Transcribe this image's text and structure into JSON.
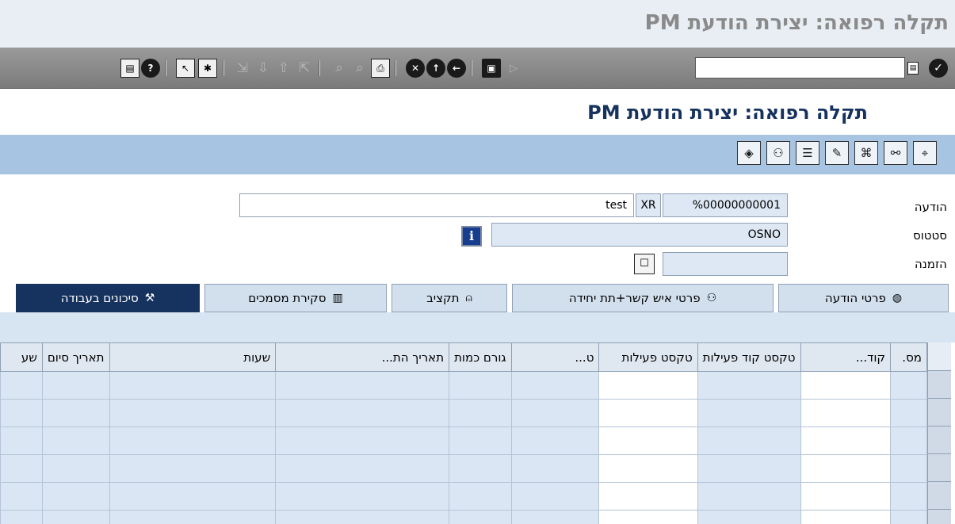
{
  "window": {
    "title": "תקלה רפואה: יצירת הודעת PM"
  },
  "toolbar": {
    "command_value": "",
    "icons": [
      "enter-icon",
      "command-field-icon",
      "next-icon",
      "save-icon",
      "back-icon",
      "exit-icon",
      "cancel-icon",
      "print-icon",
      "find-icon",
      "find-next-icon",
      "first-page-icon",
      "previous-page-icon",
      "next-page-icon",
      "last-page-icon",
      "new-session-icon",
      "shortcut-icon",
      "help-icon",
      "layout-menu-icon"
    ]
  },
  "screen": {
    "title": "תקלה רפואה: יצירת הודעת PM"
  },
  "app_toolbar": {
    "icons": [
      "display-object-icon",
      "map-icon",
      "document-icon",
      "edit-list-icon",
      "tools-icon",
      "binoculars-icon",
      "map-pin-icon"
    ]
  },
  "form": {
    "notification": {
      "label": "הודעה",
      "number": "%00000000001",
      "type": "XR",
      "description": "test"
    },
    "status": {
      "label": "סטטוס",
      "value": "OSNO"
    },
    "order": {
      "label": "הזמנה",
      "value": ""
    }
  },
  "tabs": [
    {
      "label": "פרטי הודעה",
      "icon": "notification-details-icon"
    },
    {
      "label": "פרטי איש קשר+תת יחידה",
      "icon": "contact-people-icon"
    },
    {
      "label": "תקציב",
      "icon": "budget-bell-icon"
    },
    {
      "label": "סקירת מסמכים",
      "icon": "document-overview-icon"
    },
    {
      "label": "סיכונים בעבודה",
      "icon": "work-risks-icon",
      "active": true
    }
  ],
  "table": {
    "columns": [
      "מס.",
      "קוד...",
      "טקסט קוד פעילות",
      "טקסט פעילות",
      "ט...",
      "גורם כמות",
      "תאריך הת...",
      "שעות",
      "תאריך סיום",
      "שע"
    ],
    "rows": 6
  }
}
